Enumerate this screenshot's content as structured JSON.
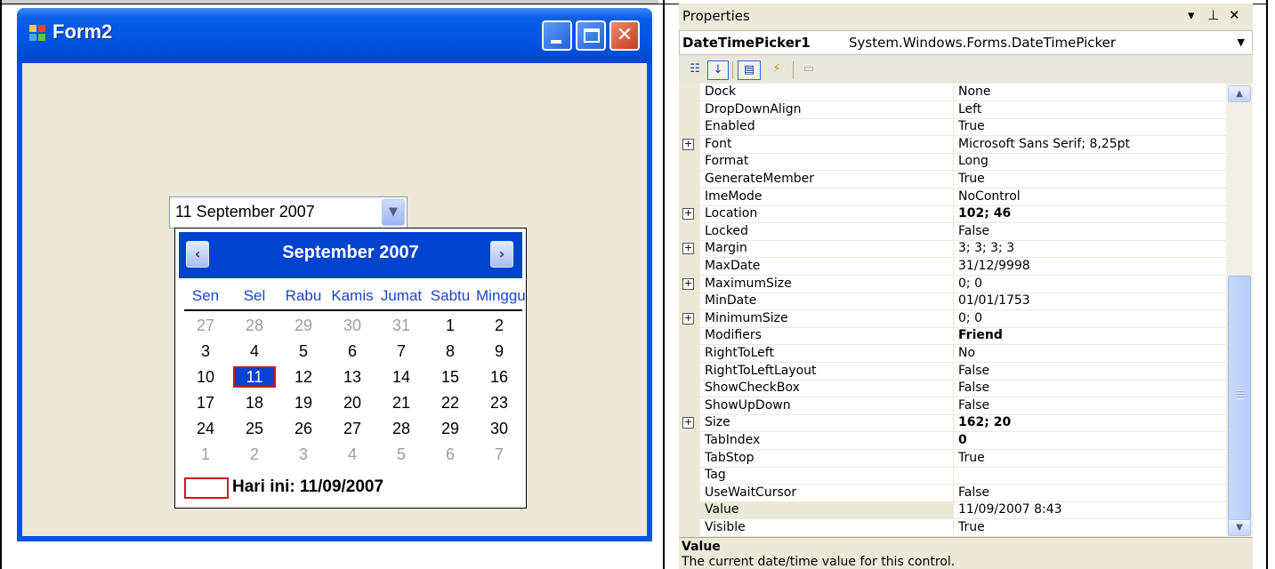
{
  "form": {
    "title": "Form2",
    "icon": "form-app-icon",
    "buttons": [
      "minimize-icon",
      "maximize-icon",
      "close-icon"
    ],
    "date_picker": {
      "value": "11 September 2007",
      "dropdown_icon": "chevron-down-icon"
    },
    "calendar": {
      "month": "September 2007",
      "prev_icon": "chevron-left-icon",
      "next_icon": "chevron-right-icon",
      "weekdays": [
        "Sen",
        "Sel",
        "Rabu",
        "Kamis",
        "Jumat",
        "Sabtu",
        "Minggu"
      ],
      "weeks": [
        [
          "27",
          "28",
          "29",
          "30",
          "31",
          "1",
          "2"
        ],
        [
          "3",
          "4",
          "5",
          "6",
          "7",
          "8",
          "9"
        ],
        [
          "10",
          "11",
          "12",
          "13",
          "14",
          "15",
          "16"
        ],
        [
          "17",
          "18",
          "19",
          "20",
          "21",
          "22",
          "23"
        ],
        [
          "24",
          "25",
          "26",
          "27",
          "28",
          "29",
          "30"
        ],
        [
          "1",
          "2",
          "3",
          "4",
          "5",
          "6",
          "7"
        ]
      ],
      "selected_day": "11",
      "today_label": "Hari ini: 11/09/2007"
    }
  },
  "properties": {
    "title": "Properties",
    "title_icons": [
      "dropdown-arrow-icon",
      "pin-icon",
      "close-icon"
    ],
    "object_name": "DateTimePicker1",
    "object_type": "System.Windows.Forms.DateTimePicker",
    "toolbar": [
      "categorized-icon",
      "alphabetical-icon",
      "properties-icon",
      "events-icon",
      "property-pages-icon"
    ],
    "rows": [
      {
        "name": "Dock",
        "value": "None",
        "expandable": false,
        "bold": false
      },
      {
        "name": "DropDownAlign",
        "value": "Left",
        "expandable": false,
        "bold": false
      },
      {
        "name": "Enabled",
        "value": "True",
        "expandable": false,
        "bold": false
      },
      {
        "name": "Font",
        "value": "Microsoft Sans Serif; 8,25pt",
        "expandable": true,
        "bold": false
      },
      {
        "name": "Format",
        "value": "Long",
        "expandable": false,
        "bold": false
      },
      {
        "name": "GenerateMember",
        "value": "True",
        "expandable": false,
        "bold": false
      },
      {
        "name": "ImeMode",
        "value": "NoControl",
        "expandable": false,
        "bold": false
      },
      {
        "name": "Location",
        "value": "102; 46",
        "expandable": true,
        "bold": true
      },
      {
        "name": "Locked",
        "value": "False",
        "expandable": false,
        "bold": false
      },
      {
        "name": "Margin",
        "value": "3; 3; 3; 3",
        "expandable": true,
        "bold": false
      },
      {
        "name": "MaxDate",
        "value": "31/12/9998",
        "expandable": false,
        "bold": false
      },
      {
        "name": "MaximumSize",
        "value": "0; 0",
        "expandable": true,
        "bold": false
      },
      {
        "name": "MinDate",
        "value": "01/01/1753",
        "expandable": false,
        "bold": false
      },
      {
        "name": "MinimumSize",
        "value": "0; 0",
        "expandable": true,
        "bold": false
      },
      {
        "name": "Modifiers",
        "value": "Friend",
        "expandable": false,
        "bold": true
      },
      {
        "name": "RightToLeft",
        "value": "No",
        "expandable": false,
        "bold": false
      },
      {
        "name": "RightToLeftLayout",
        "value": "False",
        "expandable": false,
        "bold": false
      },
      {
        "name": "ShowCheckBox",
        "value": "False",
        "expandable": false,
        "bold": false
      },
      {
        "name": "ShowUpDown",
        "value": "False",
        "expandable": false,
        "bold": false
      },
      {
        "name": "Size",
        "value": "162; 20",
        "expandable": true,
        "bold": true
      },
      {
        "name": "TabIndex",
        "value": "0",
        "expandable": false,
        "bold": true
      },
      {
        "name": "TabStop",
        "value": "True",
        "expandable": false,
        "bold": false
      },
      {
        "name": "Tag",
        "value": "",
        "expandable": false,
        "bold": false
      },
      {
        "name": "UseWaitCursor",
        "value": "False",
        "expandable": false,
        "bold": false
      },
      {
        "name": "Value",
        "value": "11/09/2007 8:43",
        "expandable": false,
        "bold": false,
        "selected": true
      },
      {
        "name": "Visible",
        "value": "True",
        "expandable": false,
        "bold": false
      }
    ],
    "scroll_icons": [
      "scroll-up-icon",
      "scroll-down-icon"
    ],
    "description": {
      "title": "Value",
      "text": "The current date/time value for this control."
    }
  },
  "colors": {
    "xp_blue": "#0054e3",
    "form_bg": "#ece9d8",
    "calendar_header": "#0043ce",
    "weekday_text": "#1747c5",
    "selection_border": "#d0151b"
  }
}
